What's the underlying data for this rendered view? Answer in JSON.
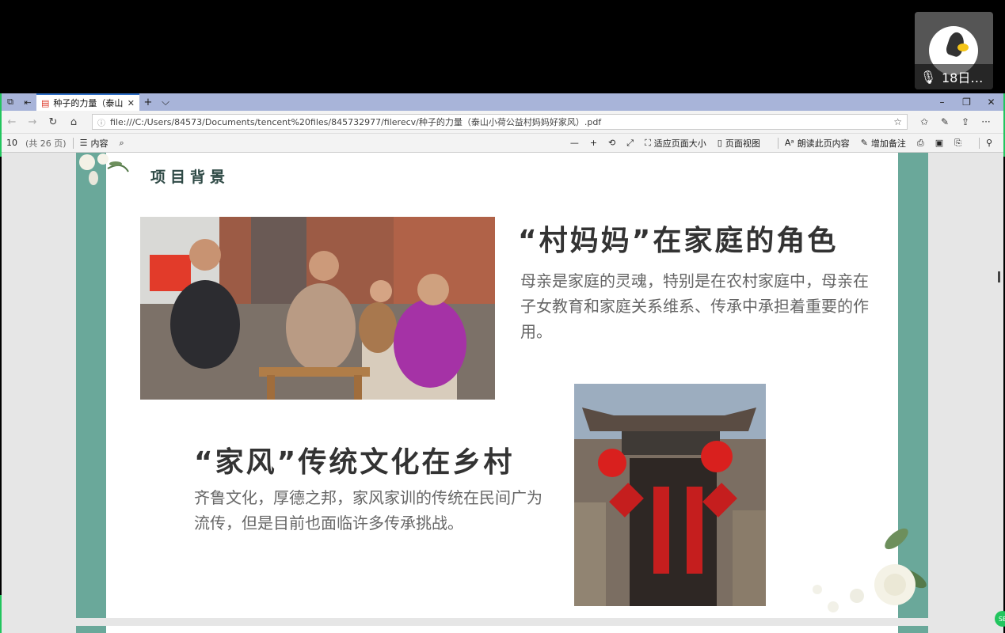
{
  "meeting": {
    "participant_name": "18日…",
    "mic_icon": "microphone-icon"
  },
  "browser": {
    "tab_title": "种子的力量（泰山",
    "tab_close": "✕",
    "new_tab": "+",
    "tab_menu": "⌵",
    "win_minimize": "–",
    "win_restore": "❐",
    "win_close": "✕",
    "url": "file:///C:/Users/84573/Documents/tencent%20files/845732977/filerecv/种子的力量（泰山小荷公益村妈妈好家风）.pdf"
  },
  "pdf_toolbar": {
    "page_number": "10",
    "page_total": "(共 26 页)",
    "contents_label": "内容",
    "fit_page_label": "适应页面大小",
    "page_view_label": "页面视图",
    "read_aloud_label": "朗读此页内容",
    "add_notes_label": "增加备注"
  },
  "slide": {
    "heading": "项目背景",
    "title1": "“村妈妈”在家庭的角色",
    "para1": "母亲是家庭的灵魂，特别是在农村家庭中，母亲在子女教育和家庭关系维系、传承中承担着重要的作用。",
    "title2": "“家风”传统文化在乡村",
    "para2": "齐鲁文化，厚德之邦，家风家训的传统在民间广为流传，但是目前也面临许多传承挑战。"
  },
  "badge": "SE",
  "colors": {
    "tab_bar": "#a8b4d9",
    "teal_band": "#6aa89a",
    "meeting_green": "#22c55e"
  }
}
